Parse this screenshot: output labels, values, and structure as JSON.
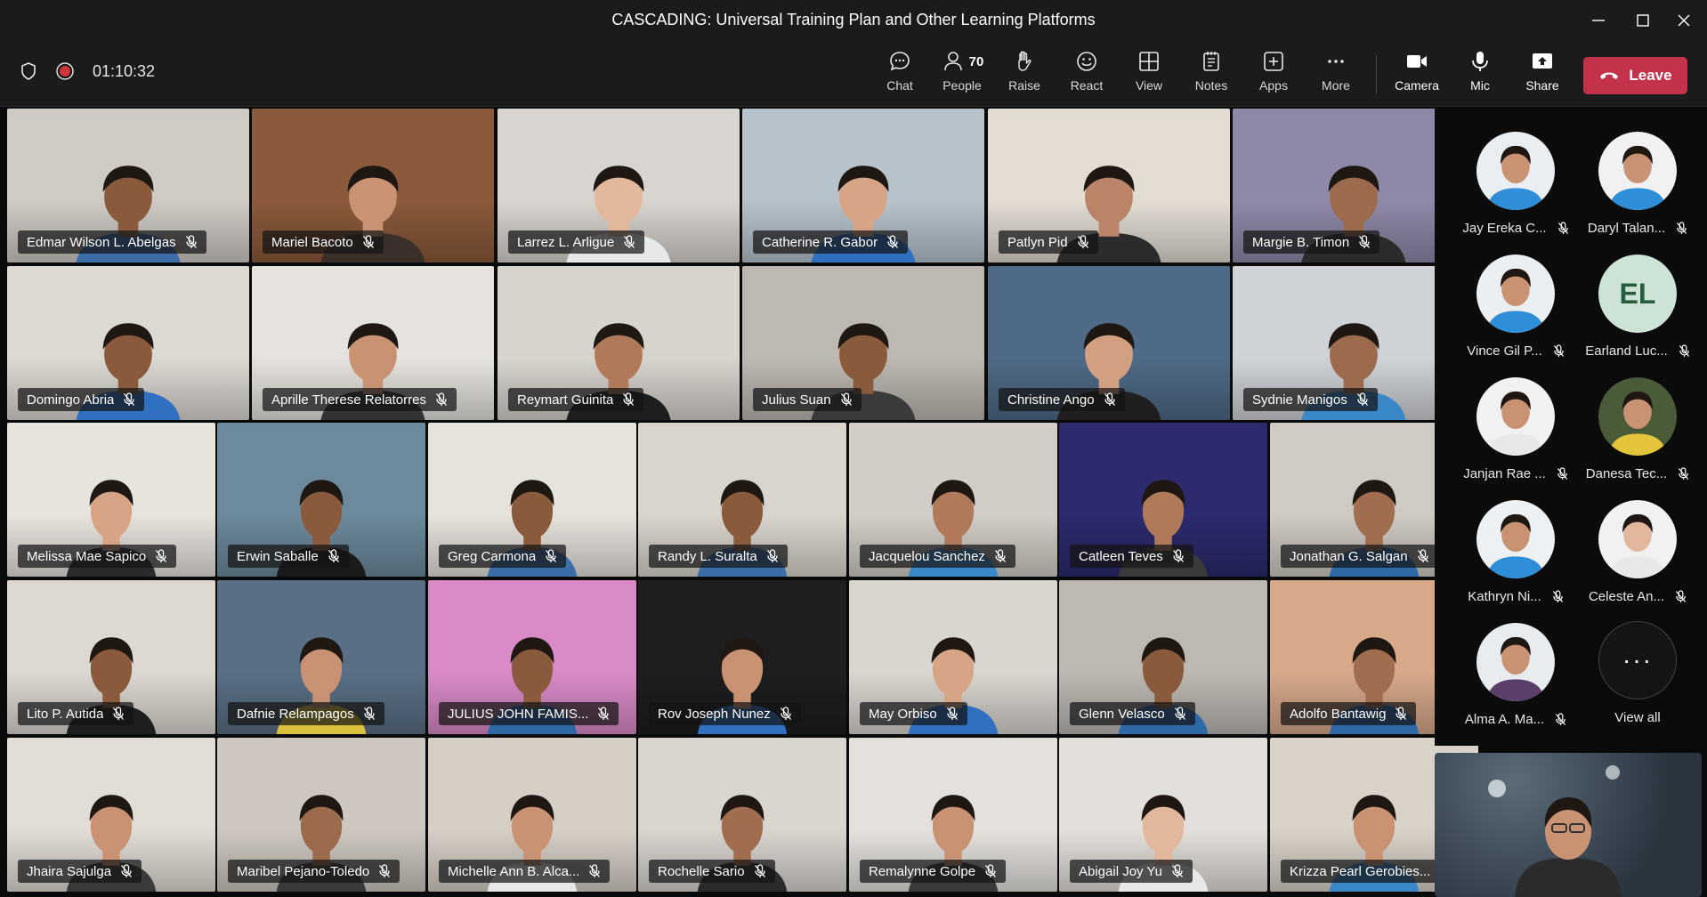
{
  "window": {
    "title": "CASCADING: Universal Training Plan and Other Learning Platforms"
  },
  "meeting": {
    "timer": "01:10:32"
  },
  "toolbar": {
    "chat": "Chat",
    "people": "People",
    "people_count": "70",
    "raise": "Raise",
    "react": "React",
    "view": "View",
    "notes": "Notes",
    "apps": "Apps",
    "more": "More",
    "camera": "Camera",
    "mic": "Mic",
    "share": "Share",
    "leave": "Leave"
  },
  "colors": {
    "leave": "#c4314b",
    "background": "#0a0a0a",
    "toolbar": "#1b1b1b"
  },
  "participants": [
    {
      "name": "Edmar Wilson L. Abelgas",
      "bg": "#cfcac4",
      "skin": "#8a5a3c",
      "shirt": "#3b6ea8"
    },
    {
      "name": "Mariel Bacoto",
      "bg": "#8b5a3a",
      "skin": "#c99373",
      "shirt": "#3b2f2a"
    },
    {
      "name": "Larrez L. Arligue",
      "bg": "#d8d4cf",
      "skin": "#e2b79c",
      "shirt": "#e8e8e8"
    },
    {
      "name": "Catherine R. Gabor",
      "bg": "#b6c2cc",
      "skin": "#d7a585",
      "shirt": "#2f71c0"
    },
    {
      "name": "Patlyn Pid",
      "bg": "#e2dcd3",
      "skin": "#b98467",
      "shirt": "#2b2b2b"
    },
    {
      "name": "Margie B. Timon",
      "bg": "#8f88a8",
      "skin": "#9c6a4c",
      "shirt": "#2b2b2b"
    },
    {
      "name": "Domingo Abria",
      "bg": "#dcd8d2",
      "skin": "#8a5a3c",
      "shirt": "#2f71c0"
    },
    {
      "name": "Aprille Therese Relatorres",
      "bg": "#e6e3de",
      "skin": "#c99373",
      "shirt": "#333333"
    },
    {
      "name": "Reymart Guinita",
      "bg": "#d7d3cd",
      "skin": "#b07a5a",
      "shirt": "#1e1e1e"
    },
    {
      "name": "Julius Suan",
      "bg": "#bdb8b1",
      "skin": "#8a5a3c",
      "shirt": "#3a3a3a"
    },
    {
      "name": "Christine Ango",
      "bg": "#4f6a86",
      "skin": "#d2a080",
      "shirt": "#1f1f1f"
    },
    {
      "name": "Sydnie Manigos",
      "bg": "#cfd2d6",
      "skin": "#9c6a4c",
      "shirt": "#3a88c8"
    },
    {
      "name": "Melissa Mae Sapico",
      "bg": "#e7e3dd",
      "skin": "#d7a585",
      "shirt": "#2b2b2b"
    },
    {
      "name": "Erwin Saballe",
      "bg": "#6d8a9c",
      "skin": "#8a5a3c",
      "shirt": "#1a1a1a"
    },
    {
      "name": "Greg Carmona",
      "bg": "#e6e2dc",
      "skin": "#8a5a3c",
      "shirt": "#3b6ea8"
    },
    {
      "name": "Randy L. Suralta",
      "bg": "#d9d4cc",
      "skin": "#8a5a3c",
      "shirt": "#3b6ea8"
    },
    {
      "name": "Jacquelou Sanchez",
      "bg": "#d2cdc6",
      "skin": "#b07a5a",
      "shirt": "#3a88c8"
    },
    {
      "name": "Catleen Teves",
      "bg": "#2c2b6e",
      "skin": "#b07a5a",
      "shirt": "#3a3a3a"
    },
    {
      "name": "Jonathan G. Salgan",
      "bg": "#cfcac2",
      "skin": "#a06d4e",
      "shirt": "#2f6aa8"
    },
    {
      "name": "Lito P. Autida",
      "bg": "#ddd8d1",
      "skin": "#8a5a3c",
      "shirt": "#1e1e1e"
    },
    {
      "name": "Dafnie Relampagos",
      "bg": "#5a6f85",
      "skin": "#c99373",
      "shirt": "#d9c13c"
    },
    {
      "name": "JULIUS JOHN FAMIS...",
      "bg": "#d98ac7",
      "skin": "#8a5a3c",
      "shirt": "#2f6aa8"
    },
    {
      "name": "Rov Joseph Nunez",
      "bg": "#1e1e1e",
      "skin": "#c99373",
      "shirt": "#2f71c0"
    },
    {
      "name": "May Orbiso",
      "bg": "#d9d5cf",
      "skin": "#d7a585",
      "shirt": "#2f71c0"
    },
    {
      "name": "Glenn Velasco",
      "bg": "#bdb8b2",
      "skin": "#8a5a3c",
      "shirt": "#2f6aa8"
    },
    {
      "name": "Adolfo Bantawig",
      "bg": "#d7a88a",
      "skin": "#a06d4e",
      "shirt": "#2f6aa8"
    },
    {
      "name": "Jhaira Sajulga",
      "bg": "#e1dcd5",
      "skin": "#c99373",
      "shirt": "#3a3a3a"
    },
    {
      "name": "Maribel Pejano-Toledo",
      "bg": "#cdc7bf",
      "skin": "#9c6a4c",
      "shirt": "#3a3a3a"
    },
    {
      "name": "Michelle Ann B. Alca...",
      "bg": "#d6cfc6",
      "skin": "#c99373",
      "shirt": "#e8e8e8"
    },
    {
      "name": "Rochelle Sario",
      "bg": "#d9d5cf",
      "skin": "#a06d4e",
      "shirt": "#2b2b2b"
    },
    {
      "name": "Remalynne Golpe",
      "bg": "#e4e1dd",
      "skin": "#c99373",
      "shirt": "#3a3a3a"
    },
    {
      "name": "Abigail Joy Yu",
      "bg": "#e3dfda",
      "skin": "#e2b79c",
      "shirt": "#e8e8e8"
    },
    {
      "name": "Krizza Pearl Gerobies...",
      "bg": "#d8d2c8",
      "skin": "#c99373",
      "shirt": "#3a88c8"
    }
  ],
  "roster": [
    {
      "name": "Jay Ereka C...",
      "type": "photo",
      "bg": "#e9eef2",
      "skin": "#c99373",
      "shirt": "#2f8ed8"
    },
    {
      "name": "Daryl Talan...",
      "type": "photo",
      "bg": "#f1f1f1",
      "skin": "#c99373",
      "shirt": "#2f8ed8"
    },
    {
      "name": "Vince Gil P...",
      "type": "photo",
      "bg": "#eceff2",
      "skin": "#c99373",
      "shirt": "#2f8ed8"
    },
    {
      "name": "Earland Luc...",
      "type": "initials",
      "initials": "EL"
    },
    {
      "name": "Janjan Rae ...",
      "type": "photo",
      "bg": "#f1f1f1",
      "skin": "#c99373",
      "shirt": "#e8e8e8"
    },
    {
      "name": "Danesa Tec...",
      "type": "photo",
      "bg": "#4a5b3a",
      "skin": "#c99373",
      "shirt": "#e3c43a"
    },
    {
      "name": "Kathryn Ni...",
      "type": "photo",
      "bg": "#eef1f3",
      "skin": "#c99373",
      "shirt": "#2f8ed8"
    },
    {
      "name": "Celeste An...",
      "type": "photo",
      "bg": "#f1f1f1",
      "skin": "#e2b79c",
      "shirt": "#e8e8e8"
    },
    {
      "name": "Alma A. Ma...",
      "type": "photo",
      "bg": "#e9ecef",
      "skin": "#c99373",
      "shirt": "#5b3f6b"
    },
    {
      "name": "View all",
      "type": "more"
    }
  ],
  "self_view": {
    "bg": "#2a3540",
    "skin": "#c99373",
    "shirt": "#2b2b2b"
  }
}
